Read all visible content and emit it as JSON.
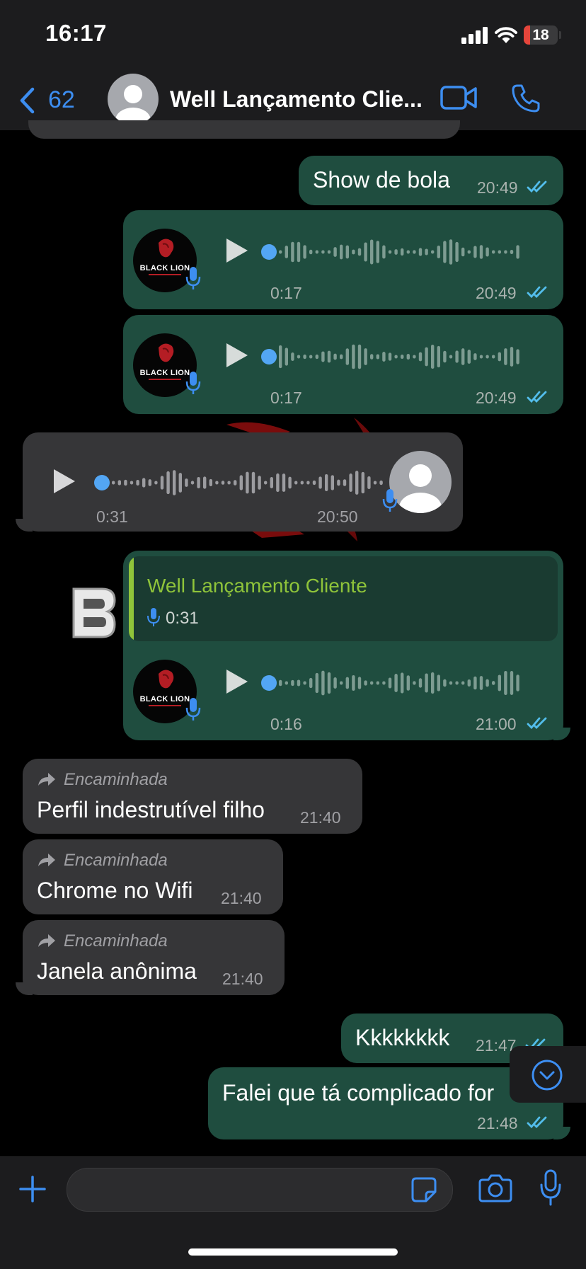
{
  "status_bar": {
    "time": "16:17",
    "battery": "18",
    "battery_level": 0.18
  },
  "header": {
    "back_count": "62",
    "contact_name": "Well Lançamento Clie..."
  },
  "colors": {
    "accent": "#3d8ef1",
    "outgoing_bubble": "#1f4d3f",
    "incoming_bubble": "#363638",
    "quote_name": "#8fc43a",
    "read_check": "#53bdeb"
  },
  "messages": {
    "m1": {
      "text": "Show de bola",
      "time": "20:49"
    },
    "a1": {
      "avatar_label": "BLACK LION",
      "duration": "0:17",
      "time": "20:49"
    },
    "a2": {
      "avatar_label": "BLACK LION",
      "duration": "0:17",
      "time": "20:49"
    },
    "a3": {
      "duration": "0:31",
      "time": "20:50"
    },
    "a4": {
      "quoted_name": "Well Lançamento Cliente",
      "quoted_duration": "0:31",
      "avatar_label": "BLACK LION",
      "duration": "0:16",
      "time": "21:00"
    },
    "f1": {
      "forwarded": "Encaminhada",
      "text": "Perfil indestrutível filho",
      "time": "21:40"
    },
    "f2": {
      "forwarded": "Encaminhada",
      "text": "Chrome no Wifi",
      "time": "21:40"
    },
    "f3": {
      "forwarded": "Encaminhada",
      "text": "Janela anônima",
      "time": "21:40"
    },
    "m2": {
      "text": "Kkkkkkkk",
      "time": "21:47"
    },
    "m3": {
      "text": "Falei que tá complicado for",
      "time": "21:48"
    }
  },
  "icons": [
    "back-chevron-icon",
    "video-call-icon",
    "phone-icon",
    "play-icon",
    "microphone-icon",
    "forward-arrow-icon",
    "read-checkmarks-icon",
    "plus-icon",
    "sticker-icon",
    "camera-icon",
    "scroll-down-icon",
    "signal-icon",
    "wifi-icon",
    "battery-icon"
  ]
}
